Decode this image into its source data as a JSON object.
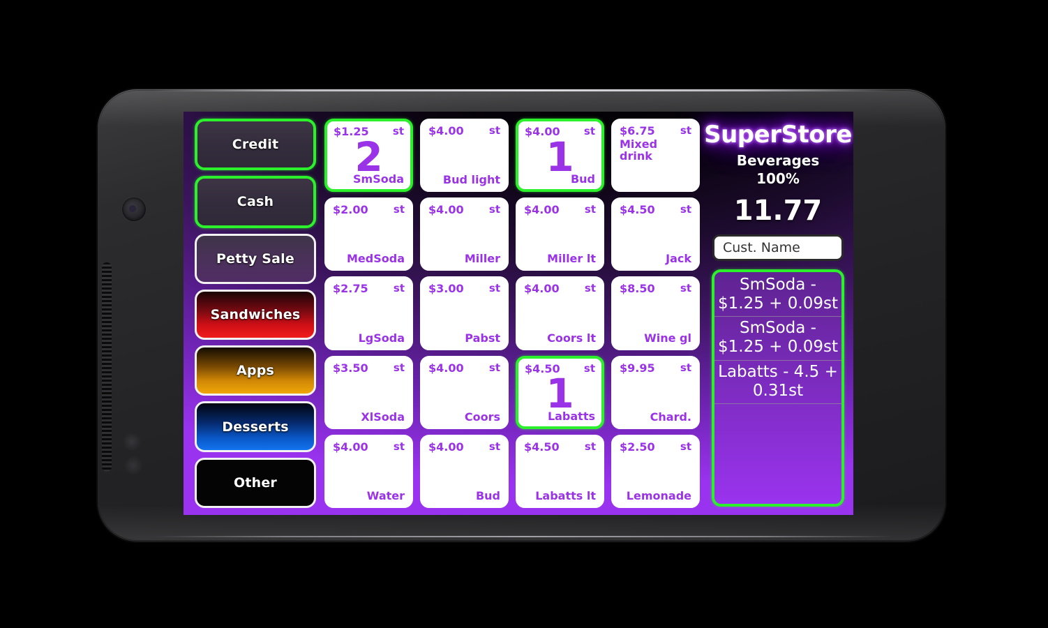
{
  "device": {
    "type": "android-phone-landscape"
  },
  "categories": [
    {
      "label": "Credit",
      "style": "sel"
    },
    {
      "label": "Cash",
      "style": "sel"
    },
    {
      "label": "Petty Sale",
      "style": "plain"
    },
    {
      "label": "Sandwiches",
      "style": "red"
    },
    {
      "label": "Apps",
      "style": "amber"
    },
    {
      "label": "Desserts",
      "style": "blue"
    },
    {
      "label": "Other",
      "style": "black"
    }
  ],
  "products": [
    {
      "price": "$1.25",
      "tax": "st",
      "name": "SmSoda",
      "qty": "2",
      "selected": true,
      "toprow": false
    },
    {
      "price": "$4.00",
      "tax": "st",
      "name": "Bud light",
      "qty": null,
      "selected": false,
      "toprow": false
    },
    {
      "price": "$4.00",
      "tax": "st",
      "name": "Bud",
      "qty": "1",
      "selected": true,
      "toprow": false
    },
    {
      "price": "$6.75",
      "tax": "st",
      "name": "Mixed drink",
      "qty": null,
      "selected": false,
      "toprow": true
    },
    {
      "price": "$2.00",
      "tax": "st",
      "name": "MedSoda",
      "qty": null,
      "selected": false,
      "toprow": false
    },
    {
      "price": "$4.00",
      "tax": "st",
      "name": "Miller",
      "qty": null,
      "selected": false,
      "toprow": false
    },
    {
      "price": "$4.00",
      "tax": "st",
      "name": "Miller lt",
      "qty": null,
      "selected": false,
      "toprow": false
    },
    {
      "price": "$4.50",
      "tax": "st",
      "name": "Jack",
      "qty": null,
      "selected": false,
      "toprow": false
    },
    {
      "price": "$2.75",
      "tax": "st",
      "name": "LgSoda",
      "qty": null,
      "selected": false,
      "toprow": false
    },
    {
      "price": "$3.00",
      "tax": "st",
      "name": "Pabst",
      "qty": null,
      "selected": false,
      "toprow": false
    },
    {
      "price": "$4.00",
      "tax": "st",
      "name": "Coors lt",
      "qty": null,
      "selected": false,
      "toprow": false
    },
    {
      "price": "$8.50",
      "tax": "st",
      "name": "Wine gl",
      "qty": null,
      "selected": false,
      "toprow": false
    },
    {
      "price": "$3.50",
      "tax": "st",
      "name": "XlSoda",
      "qty": null,
      "selected": false,
      "toprow": false
    },
    {
      "price": "$4.00",
      "tax": "st",
      "name": "Coors",
      "qty": null,
      "selected": false,
      "toprow": false
    },
    {
      "price": "$4.50",
      "tax": "st",
      "name": "Labatts",
      "qty": "1",
      "selected": true,
      "toprow": false
    },
    {
      "price": "$9.95",
      "tax": "st",
      "name": "Chard.",
      "qty": null,
      "selected": false,
      "toprow": false
    },
    {
      "price": "$4.00",
      "tax": "st",
      "name": "Water",
      "qty": null,
      "selected": false,
      "toprow": false
    },
    {
      "price": "$4.00",
      "tax": "st",
      "name": "Bud",
      "qty": null,
      "selected": false,
      "toprow": false
    },
    {
      "price": "$4.50",
      "tax": "st",
      "name": "Labatts lt",
      "qty": null,
      "selected": false,
      "toprow": false
    },
    {
      "price": "$2.50",
      "tax": "st",
      "name": "Lemonade",
      "qty": null,
      "selected": false,
      "toprow": false
    }
  ],
  "right_panel": {
    "store_name": "SuperStore",
    "category_label": "Beverages",
    "percent_label": "100%",
    "order_total": "11.77",
    "cust_name_value": "Cust. Name",
    "cust_name_placeholder": "Cust. Name",
    "receipt_items": [
      "SmSoda - $1.25 + 0.09st",
      "SmSoda - $1.25 + 0.09st",
      "Labatts - 4.5 + 0.31st"
    ]
  },
  "colors": {
    "accent_purple": "#9a33e8",
    "selection_green": "#2cf02c",
    "bg_purple_bottom": "#9a33f0",
    "bg_dark_top": "#000000",
    "red_button": "#ef1c1c",
    "amber_button": "#f0a708",
    "blue_button": "#1274ef",
    "white": "#ffffff"
  }
}
